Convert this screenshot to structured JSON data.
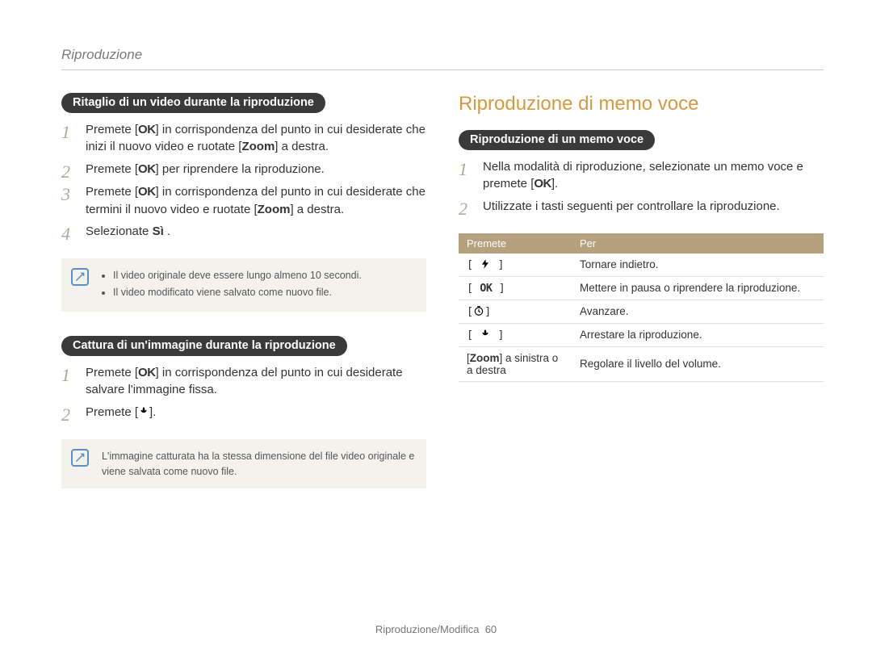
{
  "header": {
    "section": "Riproduzione"
  },
  "left": {
    "trim": {
      "pill": "Ritaglio di un video durante la riproduzione",
      "steps": [
        {
          "pre": "Premete [",
          "icon": "ok",
          "post": "] in corrispondenza del punto in cui desiderate che inizi il nuovo video e ruotate [",
          "bold": "Zoom",
          "post2": "] a destra."
        },
        {
          "pre": "Premete [",
          "icon": "ok",
          "post": "] per riprendere la riproduzione."
        },
        {
          "pre": "Premete [",
          "icon": "ok",
          "post": "] in corrispondenza del punto in cui desiderate che termini il nuovo video e ruotate [",
          "bold": "Zoom",
          "post2": "] a destra."
        },
        {
          "plain_pre": "Selezionate ",
          "bold": "Sì",
          "plain_post": " ."
        }
      ],
      "note_items": [
        "Il video originale deve essere lungo almeno 10 secondi.",
        "Il video modificato viene salvato come nuovo file."
      ]
    },
    "capture": {
      "pill": "Cattura di un'immagine durante la riproduzione",
      "steps": [
        {
          "pre": "Premete [",
          "icon": "ok",
          "post": "] in corrispondenza del punto in cui desiderate salvare l'immagine fissa."
        },
        {
          "pre": "Premete [",
          "icon": "macro",
          "post": "]."
        }
      ],
      "note_text": "L'immagine catturata ha la stessa dimensione del file video originale e viene salvata come nuovo file."
    }
  },
  "right": {
    "heading": "Riproduzione di memo voce",
    "memo": {
      "pill": "Riproduzione di un memo voce",
      "steps": [
        {
          "pre": "Nella modalità di riproduzione, selezionate un memo voce e premete [",
          "icon": "ok",
          "post": "]."
        },
        {
          "plain_pre": "Utilizzate i tasti seguenti per controllare la riproduzione."
        }
      ]
    },
    "table": {
      "head": {
        "c1": "Premete",
        "c2": "Per"
      },
      "rows": [
        {
          "key_icon": "flash",
          "desc": "Tornare indietro."
        },
        {
          "key_icon": "ok",
          "desc": "Mettere in pausa o riprendere la riproduzione."
        },
        {
          "key_icon": "timer",
          "desc": "Avanzare."
        },
        {
          "key_icon": "macro",
          "desc": "Arrestare la riproduzione."
        },
        {
          "key_html_pre": "[",
          "key_bold": "Zoom",
          "key_html_post": "] a sinistra o a destra",
          "desc": "Regolare il livello del volume."
        }
      ]
    }
  },
  "footer": {
    "text": "Riproduzione/Modifica",
    "page": "60"
  }
}
